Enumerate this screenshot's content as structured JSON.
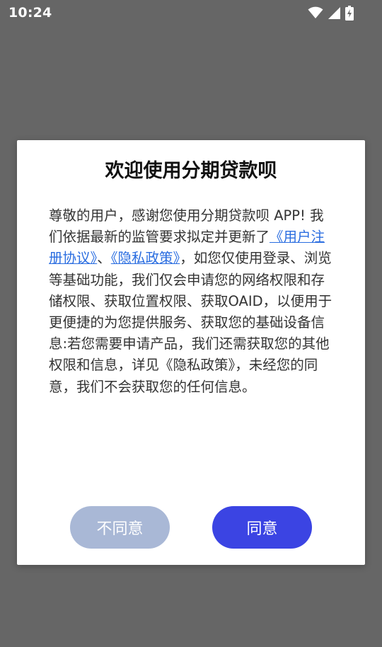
{
  "status_bar": {
    "time": "10:24",
    "icons": [
      "wifi-icon",
      "cellular-signal-icon",
      "battery-charging-icon"
    ]
  },
  "dialog": {
    "title": "欢迎使用分期贷款呗",
    "body": {
      "part1": "尊敬的用户，感谢您使用分期贷款呗 APP! 我们依据最新的监管要求拟定并更新了",
      "link_user_agreement": "《用户注册协议》",
      "separator": "、",
      "link_privacy_policy": "《隐私政策》",
      "part2": "，如您仅使用登录、浏览等基础功能，我们仅会申请您的网络权限和存储权限、获取位置权限、获取OAID，以便用于更便捷的为您提供服务、获取您的基础设备信息:若您需要申请产品，我们还需获取您的其他权限和信息，详见《隐私政策》，未经您的同意，我们不会获取您的任何信息。"
    },
    "buttons": {
      "disagree": "不同意",
      "agree": "同意"
    }
  },
  "colors": {
    "backdrop": "#666666",
    "link": "#2a6de0",
    "agree_button": "#3b44e3",
    "disagree_button": "#a9b8d6"
  }
}
